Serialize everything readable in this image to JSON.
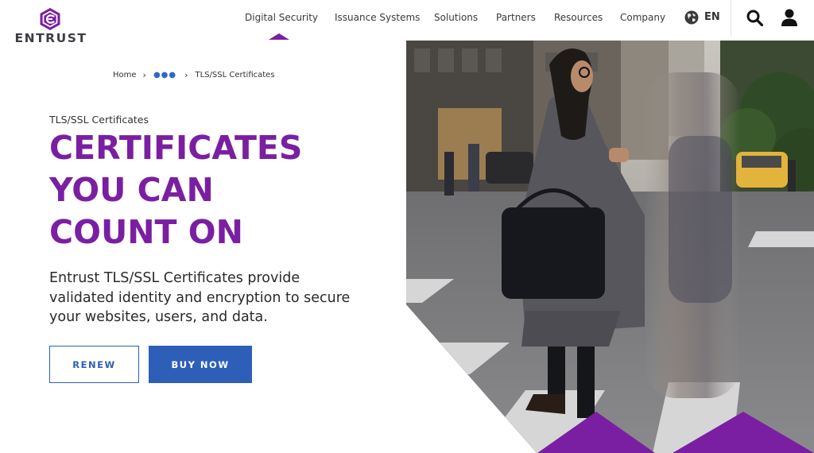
{
  "brand": {
    "logo_text": "ENTRUST",
    "accent_color": "#7b1fa2",
    "button_color": "#2e5fb8"
  },
  "nav": {
    "items": [
      {
        "label": "Digital Security"
      },
      {
        "label": "Issuance Systems"
      },
      {
        "label": "Solutions"
      },
      {
        "label": "Partners"
      },
      {
        "label": "Resources"
      },
      {
        "label": "Company"
      }
    ],
    "active_item": "Digital Security",
    "language": "EN",
    "icons": [
      "globe-icon",
      "search-icon",
      "user-icon"
    ]
  },
  "breadcrumb": {
    "home": "Home",
    "ellipsis": "●●●",
    "current": "TLS/SSL Certificates"
  },
  "hero": {
    "eyebrow": "TLS/SSL Certificates",
    "headline_lines": [
      "CERTIFICATES",
      "YOU CAN",
      "COUNT ON"
    ],
    "description": "Entrust TLS/SSL Certificates provide validated identity and encryption to secure your websites, users, and data.",
    "renew_label": "RENEW",
    "buy_label": "BUY NOW"
  }
}
